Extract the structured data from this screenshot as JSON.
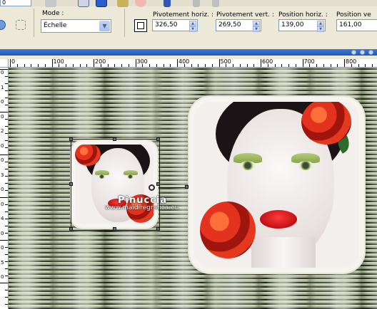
{
  "toolbar": {
    "partial_field_text": "0",
    "mode_label": "Mode :",
    "mode_value": "Échelle",
    "pivot_h_label": "Pivotement horiz. :",
    "pivot_h_value": "326,50",
    "pivot_v_label": "Pivotement vert. :",
    "pivot_v_value": "269,50",
    "pos_h_label": "Position horiz. :",
    "pos_h_value": "139,00",
    "pos_v_label": "Position ve",
    "pos_v_value": "161,00"
  },
  "ruler": {
    "horizontal_labels": [
      "0",
      "100",
      "200",
      "300",
      "400",
      "500",
      "600",
      "700",
      "800"
    ],
    "vertical_labels": [
      "0",
      "1",
      "0",
      "0",
      "2",
      "0",
      "0",
      "3",
      "0",
      "0",
      "4",
      "0",
      "0",
      "5",
      "0"
    ]
  },
  "canvas": {
    "watermark_title": "Pinuccia",
    "watermark_url": "www.maidiregrafica.eu"
  },
  "icons": [
    "toolbar-icon-1",
    "toolbar-icon-2",
    "toolbar-icon-3",
    "toolbar-icon-4",
    "cancel-icon",
    "refresh-icon",
    "scissors-icon",
    "tool-options-icon",
    "pick-tool-icon"
  ],
  "colors": {
    "panel": "#ece9d8",
    "field_border": "#7f9db9",
    "titlebar": "#2454b5",
    "canvas_base": "#a3ad8e"
  }
}
